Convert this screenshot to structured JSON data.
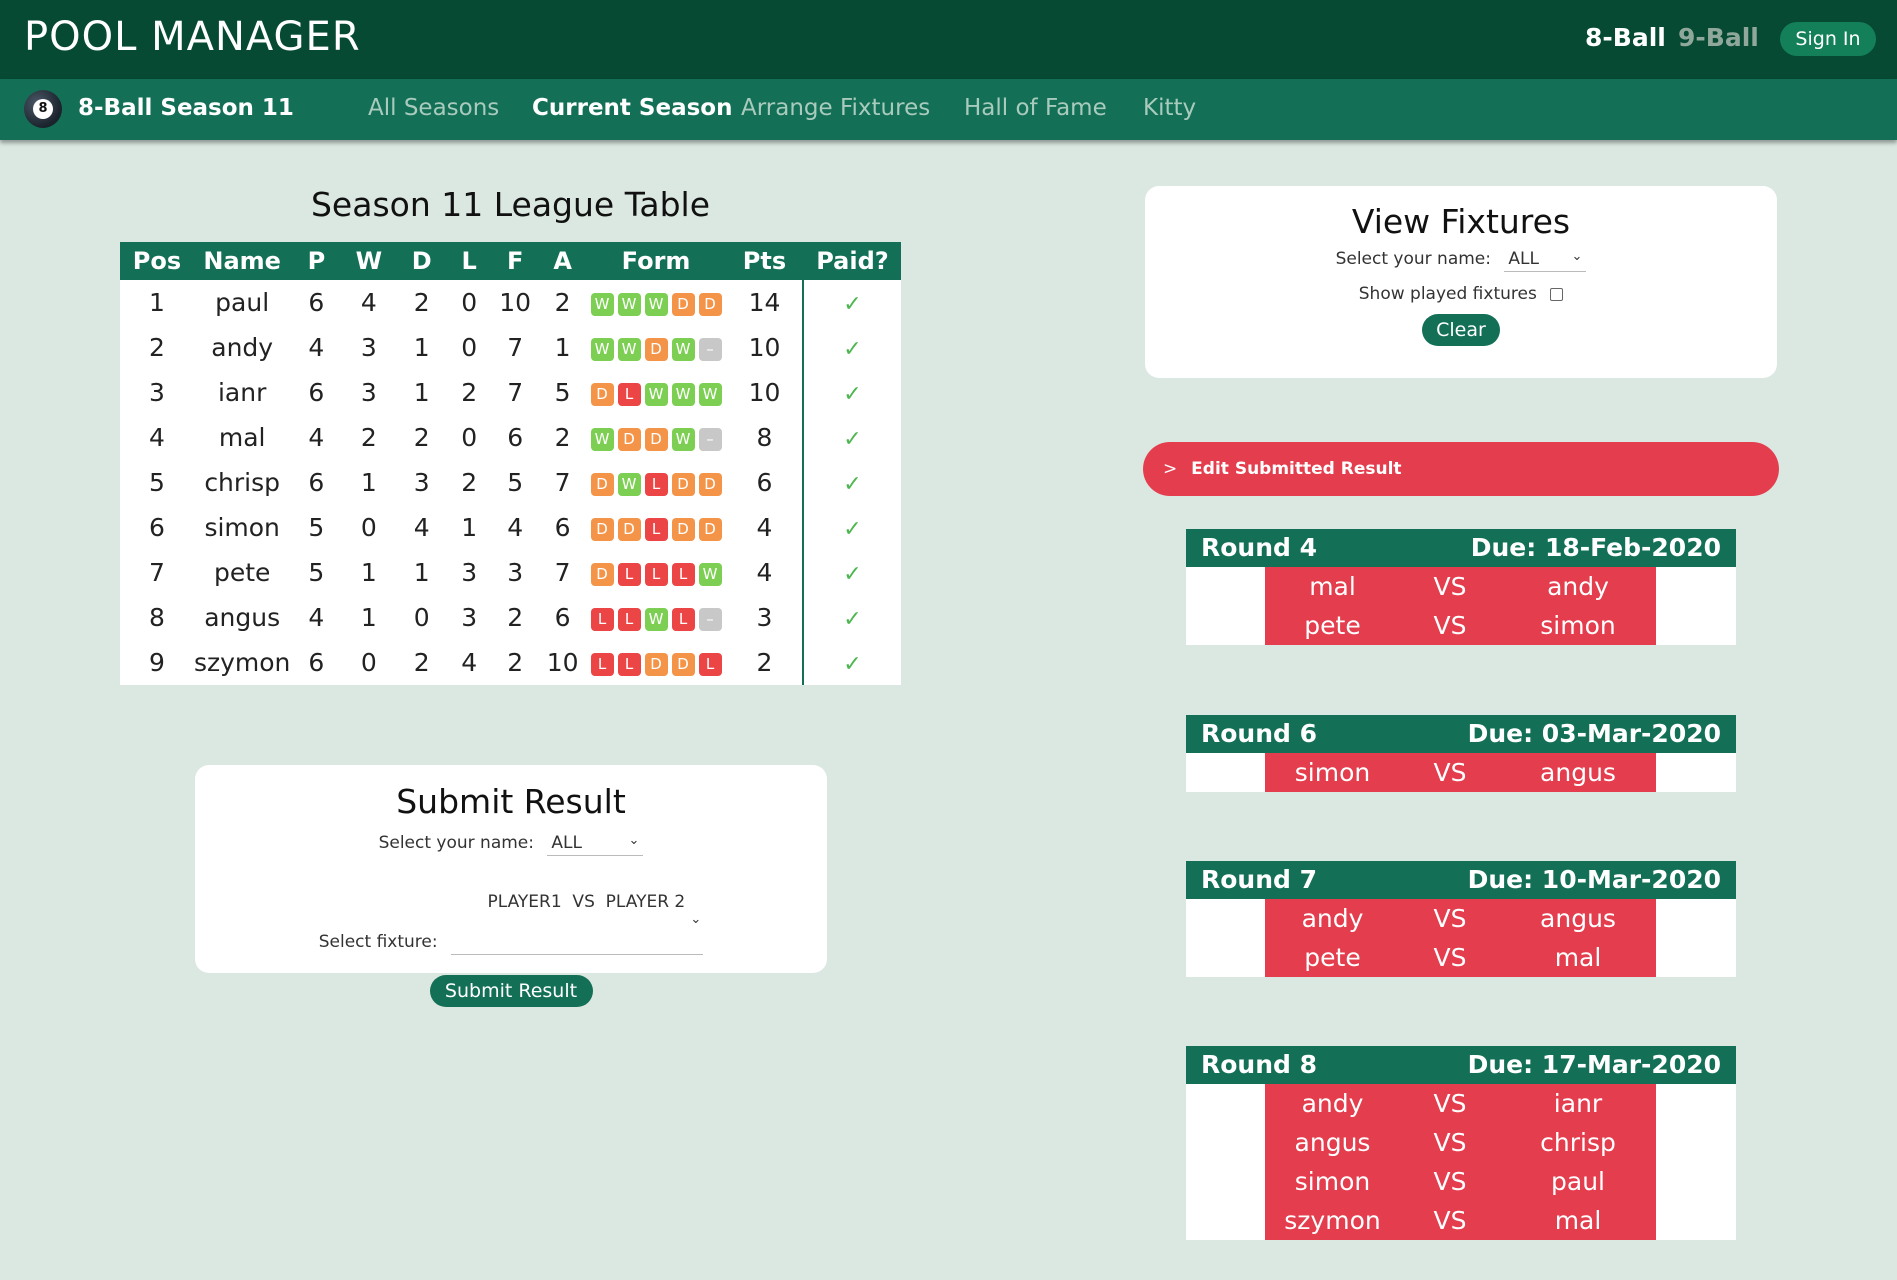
{
  "header": {
    "brand": "POOL MANAGER",
    "game_active": "8-Ball",
    "game_inactive": "9-Ball",
    "signin_label": "Sign In"
  },
  "nav": {
    "ball_number": "8",
    "season_title": "8-Ball Season 11",
    "items": [
      {
        "label": "All Seasons",
        "active": false
      },
      {
        "label": "Current Season",
        "active": true
      },
      {
        "label": "Arrange Fixtures",
        "active": false
      },
      {
        "label": "Hall of Fame",
        "active": false
      },
      {
        "label": "Kitty",
        "active": false
      }
    ]
  },
  "league": {
    "title": "Season 11 League Table",
    "columns": [
      "Pos",
      "Name",
      "P",
      "W",
      "D",
      "L",
      "F",
      "A",
      "Form",
      "Pts",
      "Paid?"
    ],
    "rows": [
      {
        "pos": "1",
        "name": "paul",
        "p": "6",
        "w": "4",
        "d": "2",
        "l": "0",
        "f": "10",
        "a": "2",
        "form": [
          "W",
          "W",
          "W",
          "D",
          "D"
        ],
        "pts": "14",
        "paid": "✓"
      },
      {
        "pos": "2",
        "name": "andy",
        "p": "4",
        "w": "3",
        "d": "1",
        "l": "0",
        "f": "7",
        "a": "1",
        "form": [
          "W",
          "W",
          "D",
          "W",
          "–"
        ],
        "pts": "10",
        "paid": "✓"
      },
      {
        "pos": "3",
        "name": "ianr",
        "p": "6",
        "w": "3",
        "d": "1",
        "l": "2",
        "f": "7",
        "a": "5",
        "form": [
          "D",
          "L",
          "W",
          "W",
          "W"
        ],
        "pts": "10",
        "paid": "✓"
      },
      {
        "pos": "4",
        "name": "mal",
        "p": "4",
        "w": "2",
        "d": "2",
        "l": "0",
        "f": "6",
        "a": "2",
        "form": [
          "W",
          "D",
          "D",
          "W",
          "–"
        ],
        "pts": "8",
        "paid": "✓"
      },
      {
        "pos": "5",
        "name": "chrisp",
        "p": "6",
        "w": "1",
        "d": "3",
        "l": "2",
        "f": "5",
        "a": "7",
        "form": [
          "D",
          "W",
          "L",
          "D",
          "D"
        ],
        "pts": "6",
        "paid": "✓"
      },
      {
        "pos": "6",
        "name": "simon",
        "p": "5",
        "w": "0",
        "d": "4",
        "l": "1",
        "f": "4",
        "a": "6",
        "form": [
          "D",
          "D",
          "L",
          "D",
          "D"
        ],
        "pts": "4",
        "paid": "✓"
      },
      {
        "pos": "7",
        "name": "pete",
        "p": "5",
        "w": "1",
        "d": "1",
        "l": "3",
        "f": "3",
        "a": "7",
        "form": [
          "D",
          "L",
          "L",
          "L",
          "W"
        ],
        "pts": "4",
        "paid": "✓"
      },
      {
        "pos": "8",
        "name": "angus",
        "p": "4",
        "w": "1",
        "d": "0",
        "l": "3",
        "f": "2",
        "a": "6",
        "form": [
          "L",
          "L",
          "W",
          "L",
          "–"
        ],
        "pts": "3",
        "paid": "✓"
      },
      {
        "pos": "9",
        "name": "szymon",
        "p": "6",
        "w": "0",
        "d": "2",
        "l": "4",
        "f": "2",
        "a": "10",
        "form": [
          "L",
          "L",
          "D",
          "D",
          "L"
        ],
        "pts": "2",
        "paid": "✓"
      }
    ]
  },
  "submit": {
    "title": "Submit Result",
    "name_label": "Select your name:",
    "name_value": "ALL",
    "fixture_label": "Select fixture:",
    "fixture_value": "PLAYER1  VS  PLAYER 2",
    "button_label": "Submit Result"
  },
  "view": {
    "title": "View Fixtures",
    "name_label": "Select your name:",
    "name_value": "ALL",
    "played_label": "Show played fixtures",
    "clear_label": "Clear"
  },
  "edit_label": "Edit Submitted Result",
  "rounds": [
    {
      "title": "Round 4",
      "due": "Due: 18-Feb-2020",
      "fixtures": [
        {
          "p1": "mal",
          "vs": "VS",
          "p2": "andy"
        },
        {
          "p1": "pete",
          "vs": "VS",
          "p2": "simon"
        }
      ]
    },
    {
      "title": "Round 6",
      "due": "Due: 03-Mar-2020",
      "fixtures": [
        {
          "p1": "simon",
          "vs": "VS",
          "p2": "angus"
        }
      ]
    },
    {
      "title": "Round 7",
      "due": "Due: 10-Mar-2020",
      "fixtures": [
        {
          "p1": "andy",
          "vs": "VS",
          "p2": "angus"
        },
        {
          "p1": "pete",
          "vs": "VS",
          "p2": "mal"
        }
      ]
    },
    {
      "title": "Round 8",
      "due": "Due: 17-Mar-2020",
      "fixtures": [
        {
          "p1": "andy",
          "vs": "VS",
          "p2": "ianr"
        },
        {
          "p1": "angus",
          "vs": "VS",
          "p2": "chrisp"
        },
        {
          "p1": "simon",
          "vs": "VS",
          "p2": "paul"
        },
        {
          "p1": "szymon",
          "vs": "VS",
          "p2": "mal"
        }
      ]
    }
  ],
  "colors": {
    "dark_green": "#064a33",
    "nav_green": "#137056",
    "red": "#e43d4d",
    "background": "#dbe8e1",
    "form_win": "#7ccf52",
    "form_draw": "#f39448",
    "form_loss": "#ec4545"
  }
}
